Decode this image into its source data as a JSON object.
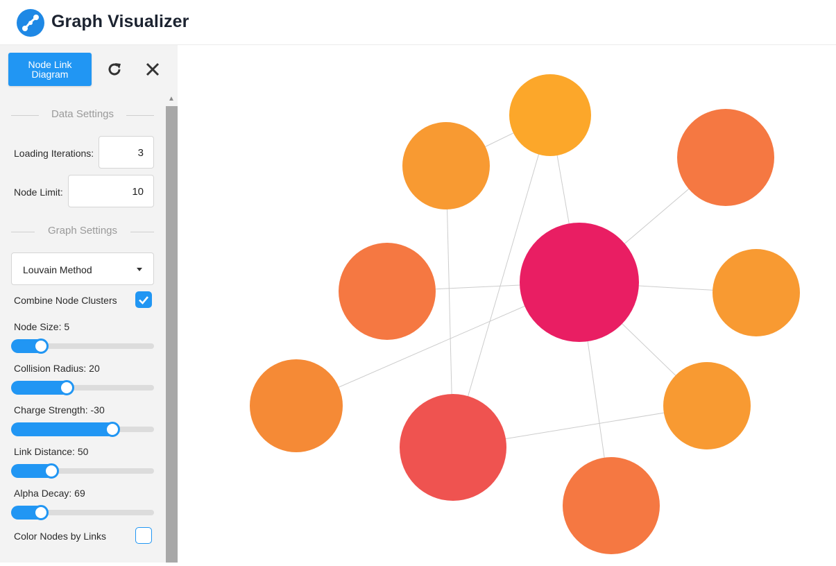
{
  "header": {
    "title": "Graph Visualizer",
    "logo_icon": "graph-logo-icon"
  },
  "toolbar": {
    "diagram_button": "Node Link Diagram",
    "refresh_icon": "refresh-icon",
    "close_icon": "close-icon"
  },
  "data_settings": {
    "title": "Data Settings",
    "loading_iterations": {
      "label": "Loading Iterations:",
      "value": "3"
    },
    "node_limit": {
      "label": "Node Limit:",
      "value": "10"
    }
  },
  "graph_settings": {
    "title": "Graph Settings",
    "algorithm": "Louvain Method",
    "combine_clusters": {
      "label": "Combine Node Clusters",
      "checked": true
    },
    "node_size": {
      "label": "Node Size: 5",
      "fraction": 0.18
    },
    "collision_radius": {
      "label": "Collision Radius: 20",
      "fraction": 0.36
    },
    "charge_strength": {
      "label": "Charge Strength: -30",
      "fraction": 0.68
    },
    "link_distance": {
      "label": "Link Distance: 50",
      "fraction": 0.25
    },
    "alpha_decay": {
      "label": "Alpha Decay: 69",
      "fraction": 0.18
    },
    "color_by_links": {
      "label": "Color Nodes by Links",
      "checked": false
    }
  },
  "colors": {
    "accent": "#2196f3",
    "node_pink": "#e91e63",
    "node_red": "#ef5350",
    "node_orange": "#f57842",
    "node_light_orange": "#f89a32",
    "node_amber": "#fca72a"
  },
  "graph": {
    "nodes": [
      {
        "id": "hub",
        "color": "#e91e63"
      },
      {
        "id": "top",
        "color": "#fca72a"
      },
      {
        "id": "upper-left",
        "color": "#f89a32"
      },
      {
        "id": "upper-right",
        "color": "#f57842"
      },
      {
        "id": "left",
        "color": "#f57842"
      },
      {
        "id": "right",
        "color": "#f89a32"
      },
      {
        "id": "far-left",
        "color": "#f58a36"
      },
      {
        "id": "bottom-left",
        "color": "#ef5350"
      },
      {
        "id": "bottom-right",
        "color": "#f89a32"
      },
      {
        "id": "bottom",
        "color": "#f57842"
      }
    ],
    "links": [
      [
        "top",
        "upper-left"
      ],
      [
        "top",
        "hub"
      ],
      [
        "top",
        "bottom-left"
      ],
      [
        "upper-left",
        "bottom-left"
      ],
      [
        "upper-right",
        "hub"
      ],
      [
        "left",
        "hub"
      ],
      [
        "right",
        "hub"
      ],
      [
        "far-left",
        "hub"
      ],
      [
        "hub",
        "bottom-right"
      ],
      [
        "hub",
        "bottom"
      ],
      [
        "bottom-left",
        "bottom-right"
      ]
    ]
  }
}
